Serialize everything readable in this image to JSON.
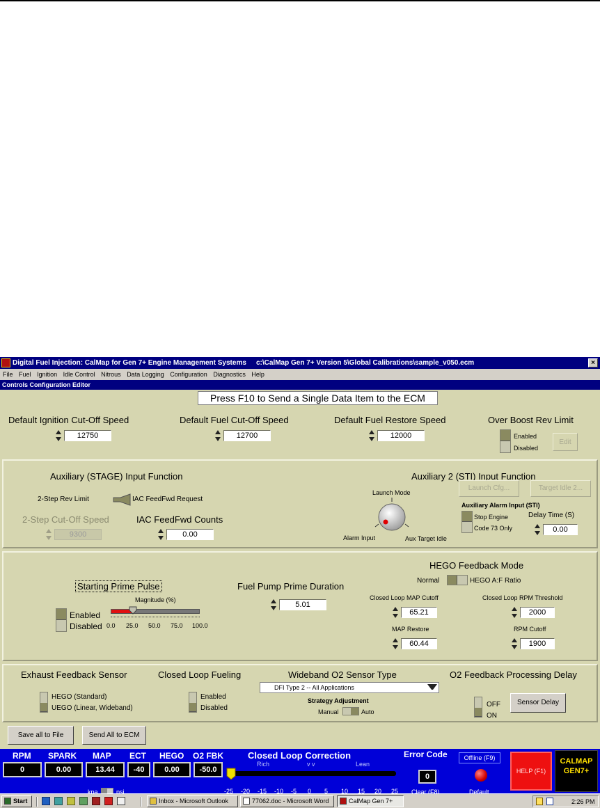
{
  "window": {
    "title": "Digital Fuel Injection:  CalMap for Gen 7+ Engine Management Systems",
    "path": "c:\\CalMap Gen 7+ Version 5\\Global Calibrations\\sample_v050.ecm",
    "close": "×"
  },
  "menu": [
    "File",
    "Fuel",
    "Ignition",
    "Idle Control",
    "Nitrous",
    "Data Logging",
    "Configuration",
    "Diagnostics",
    "Help"
  ],
  "panel_title": "Controls Configuration Editor",
  "banner": "Press F10 to Send a Single Data Item to the ECM",
  "top": {
    "ign_cut": {
      "label": "Default Ignition Cut-Off Speed",
      "value": "12750"
    },
    "fuel_cut": {
      "label": "Default Fuel Cut-Off Speed",
      "value": "12700"
    },
    "fuel_restore": {
      "label": "Default Fuel Restore Speed",
      "value": "12000"
    },
    "over_boost": {
      "label": "Over Boost Rev Limit",
      "enabled": "Enabled",
      "disabled": "Disabled",
      "edit": "Edit"
    }
  },
  "aux": {
    "title": "Auxiliary (STAGE) Input Function",
    "two_step": "2-Step Rev Limit",
    "iac_req": "IAC FeedFwd Request",
    "two_step_cut": "2-Step Cut-Off Speed",
    "two_step_val": "9300",
    "iac_counts": "IAC FeedFwd Counts",
    "iac_val": "0.00"
  },
  "aux2": {
    "title": "Auxiliary 2 (STI) Input Function",
    "launch_mode": "Launch Mode",
    "alarm_input": "Alarm Input",
    "aux_target": "Aux Target Idle",
    "launch_cfg": "Launch Cfg...",
    "target_idle": "Target Idle 2...",
    "alarm_title": "Auxiliary Alarm Input (STI)",
    "stop_engine": "Stop Engine",
    "code73": "Code 73 Only",
    "delay_label": "Delay Time (S)",
    "delay_val": "0.00"
  },
  "prime": {
    "title": "Starting Prime Pulse",
    "magnitude": "Magnitude (%)",
    "enabled": "Enabled",
    "disabled": "Disabled",
    "ticks": [
      "0.0",
      "25.0",
      "50.0",
      "75.0",
      "100.0"
    ],
    "magnitude_value": 0.25,
    "pump_label": "Fuel Pump Prime Duration",
    "pump_val": "5.01"
  },
  "hego": {
    "title": "HEGO Feedback Mode",
    "normal": "Normal",
    "af": "HEGO A:F Ratio",
    "map_cut_label": "Closed Loop MAP Cutoff",
    "map_cut": "65.21",
    "rpm_thr_label": "Closed Loop RPM Threshold",
    "rpm_thr": "2000",
    "map_restore_label": "MAP Restore",
    "map_restore": "60.44",
    "rpm_cut_label": "RPM Cutoff",
    "rpm_cut": "1900"
  },
  "bottom": {
    "exhaust": "Exhaust Feedback Sensor",
    "hego_std": "HEGO (Standard)",
    "uego": "UEGO (Linear, Wideband)",
    "cl_fuel": "Closed Loop Fueling",
    "enabled": "Enabled",
    "disabled": "Disabled",
    "wb_title": "Wideband O2 Sensor Type",
    "wb_value": "DFI Type 2 -- All Applications",
    "strategy": "Strategy Adjustment",
    "manual": "Manual",
    "auto": "Auto",
    "o2_delay": "O2 Feedback Processing Delay",
    "off": "OFF",
    "on": "ON",
    "sensor_delay": "Sensor Delay"
  },
  "actions": {
    "save": "Save all to File",
    "send": "Send All to ECM"
  },
  "gauges": [
    {
      "name": "RPM",
      "value": "0"
    },
    {
      "name": "SPARK",
      "value": "0.00"
    },
    {
      "name": "MAP",
      "value": "13.44"
    },
    {
      "name": "ECT",
      "value": "-40"
    },
    {
      "name": "HEGO",
      "value": "0.00"
    },
    {
      "name": "O2 FBK",
      "value": "-50.0"
    }
  ],
  "units": {
    "kpa": "kpa",
    "psi": "psi"
  },
  "closed_loop": {
    "title": "Closed Loop Correction",
    "rich": "Rich",
    "mid": "v v",
    "lean": "Lean",
    "ticks": [
      "-25",
      "-20",
      "-15",
      "-10",
      "-5",
      "0",
      "5",
      "10",
      "15",
      "20",
      "25"
    ],
    "value": -25
  },
  "error": {
    "title": "Error Code",
    "value": "0",
    "clear": "Clear (F8)"
  },
  "offline": {
    "label": "Offline (F9)",
    "default": "Default"
  },
  "help": "HELP (F1)",
  "logo": "CALMAP GEN7+",
  "taskbar": {
    "start": "Start",
    "items": [
      "Inbox - Microsoft Outlook",
      "77062.doc - Microsoft Word",
      "CalMap Gen 7+"
    ],
    "clock": "2:26 PM"
  },
  "colors": {
    "window_bg": "#d6d6b0",
    "status_bg": "#0000d8",
    "title_bg": "#000080",
    "help_bg": "#ee1010",
    "magnitude_bar": "#e01010"
  }
}
